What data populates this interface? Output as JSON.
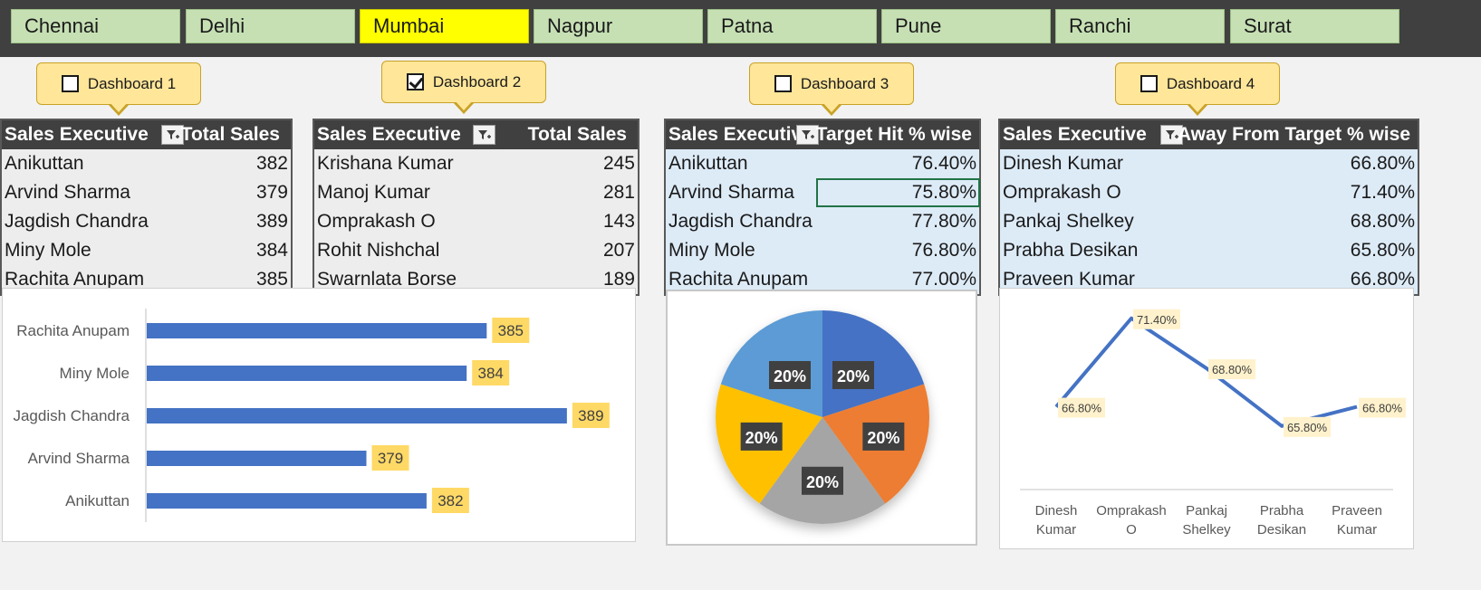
{
  "cities": [
    {
      "label": "Chennai",
      "selected": false
    },
    {
      "label": "Delhi",
      "selected": false
    },
    {
      "label": "Mumbai",
      "selected": true
    },
    {
      "label": "Nagpur",
      "selected": false
    },
    {
      "label": "Patna",
      "selected": false
    },
    {
      "label": "Pune",
      "selected": false
    },
    {
      "label": "Ranchi",
      "selected": false
    },
    {
      "label": "Surat",
      "selected": false
    }
  ],
  "dashboards": [
    {
      "label": "Dashboard 1",
      "checked": false
    },
    {
      "label": "Dashboard 2",
      "checked": true
    },
    {
      "label": "Dashboard 3",
      "checked": false
    },
    {
      "label": "Dashboard 4",
      "checked": false
    }
  ],
  "tables": [
    {
      "col1": "Sales Executive",
      "col2": "Total Sales",
      "rows": [
        [
          "Anikuttan",
          "382"
        ],
        [
          "Arvind Sharma",
          "379"
        ],
        [
          "Jagdish Chandra",
          "389"
        ],
        [
          "Miny Mole",
          "384"
        ],
        [
          "Rachita Anupam",
          "385"
        ]
      ]
    },
    {
      "col1": "Sales Executive",
      "col2": "Total Sales",
      "rows": [
        [
          "Krishana Kumar",
          "245"
        ],
        [
          "Manoj Kumar",
          "281"
        ],
        [
          "Omprakash O",
          "143"
        ],
        [
          "Rohit Nishchal",
          "207"
        ],
        [
          "Swarnlata Borse",
          "189"
        ]
      ]
    },
    {
      "col1": "Sales Executive",
      "col2": "Target Hit % wise",
      "rows": [
        [
          "Anikuttan",
          "76.40%"
        ],
        [
          "Arvind Sharma",
          "75.80%"
        ],
        [
          "Jagdish Chandra",
          "77.80%"
        ],
        [
          "Miny Mole",
          "76.80%"
        ],
        [
          "Rachita Anupam",
          "77.00%"
        ]
      ]
    },
    {
      "col1": "Sales Executive",
      "col2": "Away From Target % wise",
      "rows": [
        [
          "Dinesh Kumar",
          "66.80%"
        ],
        [
          "Omprakash O",
          "71.40%"
        ],
        [
          "Pankaj Shelkey",
          "68.80%"
        ],
        [
          "Prabha Desikan",
          "65.80%"
        ],
        [
          "Praveen Kumar",
          "66.80%"
        ]
      ]
    }
  ],
  "colors": {
    "bar": "#4472c4",
    "label_bg": "#ffd966",
    "pie": [
      "#4472c4",
      "#ed7d31",
      "#a5a5a5",
      "#ffc000",
      "#5b9bd5"
    ],
    "line": "#4472c4"
  },
  "chart_data": [
    {
      "type": "bar",
      "categories": [
        "Rachita Anupam",
        "Miny Mole",
        "Jagdish Chandra",
        "Arvind Sharma",
        "Anikuttan"
      ],
      "values": [
        385,
        384,
        389,
        379,
        382
      ],
      "xlim": [
        368,
        390
      ]
    },
    {
      "type": "pie",
      "values": [
        20,
        20,
        20,
        20,
        20
      ],
      "labels": [
        "20%",
        "20%",
        "20%",
        "20%",
        "20%"
      ]
    },
    {
      "type": "line",
      "categories": [
        [
          "Dinesh",
          "Kumar"
        ],
        [
          "Omprakash",
          "O"
        ],
        [
          "Pankaj",
          "Shelkey"
        ],
        [
          "Prabha",
          "Desikan"
        ],
        [
          "Praveen",
          "Kumar"
        ]
      ],
      "values": [
        66.8,
        71.4,
        68.8,
        65.8,
        66.8
      ],
      "labels": [
        "66.80%",
        "71.40%",
        "68.80%",
        "65.80%",
        "66.80%"
      ],
      "ylim": [
        62.5,
        72
      ]
    }
  ]
}
